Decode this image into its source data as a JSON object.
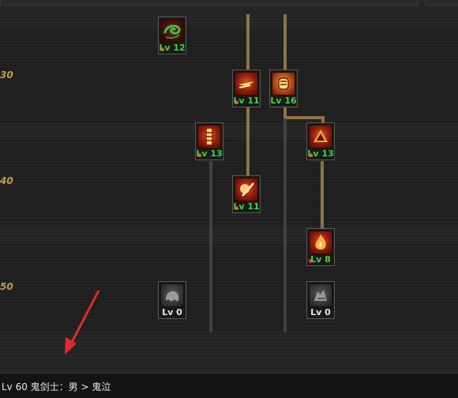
{
  "level_markers": [
    {
      "label": "30"
    },
    {
      "label": "40"
    },
    {
      "label": "50"
    }
  ],
  "skills": [
    {
      "id": "skill-a",
      "level": "Lv 12",
      "state": "learned",
      "icon": "green-swirl-icon"
    },
    {
      "id": "skill-b",
      "level": "Lv 11",
      "state": "learned",
      "icon": "dash-slash-icon"
    },
    {
      "id": "skill-c",
      "level": "Lv 16",
      "state": "learned",
      "icon": "orange-fist-icon"
    },
    {
      "id": "skill-d",
      "level": "Lv 13",
      "state": "learned",
      "icon": "flame-pillar-icon"
    },
    {
      "id": "skill-e",
      "level": "Lv 13",
      "state": "learned",
      "icon": "fire-burst-icon"
    },
    {
      "id": "skill-f",
      "level": "Lv 11",
      "state": "learned",
      "icon": "skull-slash-icon"
    },
    {
      "id": "skill-g",
      "level": "Lv 8",
      "state": "learned",
      "icon": "blaze-icon"
    },
    {
      "id": "skill-h",
      "level": "Lv 0",
      "state": "locked",
      "icon": "gray-ghost-icon"
    },
    {
      "id": "skill-i",
      "level": "Lv 0",
      "state": "locked",
      "icon": "gray-wolf-icon"
    }
  ],
  "status": {
    "text": "Lv 60 鬼剑士：男 > 鬼泣"
  },
  "colors": {
    "marker": "#c69a48",
    "level_learned": "#3bd34a",
    "level_locked": "#e6e6e6",
    "connector_active": "#8d7448",
    "connector_inactive": "#424242",
    "annotation_arrow": "#e02a2a"
  }
}
